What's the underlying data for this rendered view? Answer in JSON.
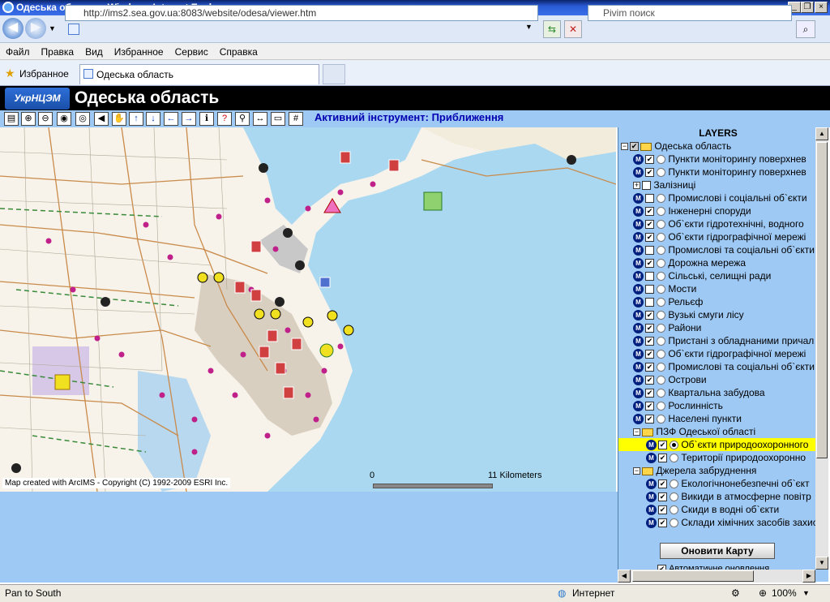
{
  "window": {
    "title": "Одеська область - Windows Internet Explorer"
  },
  "browser": {
    "url": "http://ims2.sea.gov.ua:8083/website/odesa/viewer.htm",
    "search_placeholder": "Pivim поиск",
    "menu": [
      "Файл",
      "Правка",
      "Вид",
      "Избранное",
      "Сервис",
      "Справка"
    ],
    "favorites_label": "Избранное",
    "tab_title": "Одеська область"
  },
  "app": {
    "logo_text": "УкрНЦЭМ",
    "title": "Одеська область",
    "active_tool_label": "Активний інструмент: Приближення"
  },
  "map": {
    "copyright": "Map created with ArcIMS - Copyright (C) 1992-2009 ESRI Inc.",
    "scale_start": "0",
    "scale_end": "11",
    "scale_unit": "Kilometers"
  },
  "layers": {
    "title": "LAYERS",
    "items": [
      {
        "label": "Одеська область",
        "kind": "root"
      },
      {
        "label": "Пункти моніторингу поверхнев",
        "checked": true
      },
      {
        "label": "Пункти моніторингу поверхнев",
        "checked": true
      },
      {
        "label": "Залізниці",
        "kind": "sub"
      },
      {
        "label": "Промислові і соціальні об`єкти",
        "checked": false
      },
      {
        "label": "Інженерні споруди",
        "checked": true
      },
      {
        "label": "Об`єкти гідротехнічні, водного",
        "checked": true
      },
      {
        "label": "Об`єкти гідрографічної мережі",
        "checked": true
      },
      {
        "label": "Промислові та соціальні об`єкти",
        "checked": false
      },
      {
        "label": "Дорожна мережа",
        "checked": true
      },
      {
        "label": "Сільські, селищні ради",
        "checked": false
      },
      {
        "label": "Мости",
        "checked": false
      },
      {
        "label": "Рельєф",
        "checked": false
      },
      {
        "label": "Вузькі смуги лісу",
        "checked": true
      },
      {
        "label": "Райони",
        "checked": true
      },
      {
        "label": "Пристані з обладнаними причал",
        "checked": true
      },
      {
        "label": "Об`єкти гідрографічної мережі",
        "checked": true
      },
      {
        "label": "Промислові та соціальні об`єкти",
        "checked": true
      },
      {
        "label": "Острови",
        "checked": true
      },
      {
        "label": "Квартальна забудова",
        "checked": true
      },
      {
        "label": "Рослинність",
        "checked": true
      },
      {
        "label": "Населені пункти",
        "checked": true
      },
      {
        "label": "ПЗФ Одеської області",
        "kind": "group"
      },
      {
        "label": "Об`єкти природоохоронного",
        "checked": true,
        "active": true
      },
      {
        "label": "Території природоохоронно",
        "checked": true
      },
      {
        "label": "Джерела забруднення",
        "kind": "group"
      },
      {
        "label": "Екологічнонебезпечні об`єкт",
        "checked": true
      },
      {
        "label": "Викиди в атмосферне повітр",
        "checked": true
      },
      {
        "label": "Скиди в водні об`єкти",
        "checked": true
      },
      {
        "label": "Склади хімічних засобів захис",
        "checked": true
      }
    ],
    "refresh_button": "Оновити Карту",
    "auto_update_label": "Автоматичне оновлення"
  },
  "status": {
    "left_text": "Pan to South",
    "zone": "Интернет",
    "zoom": "100%"
  },
  "colors": {
    "sea": "#a9d8f0",
    "land": "#f7f3ea",
    "panel": "#9fc9f5",
    "highlight": "#ffff00"
  }
}
